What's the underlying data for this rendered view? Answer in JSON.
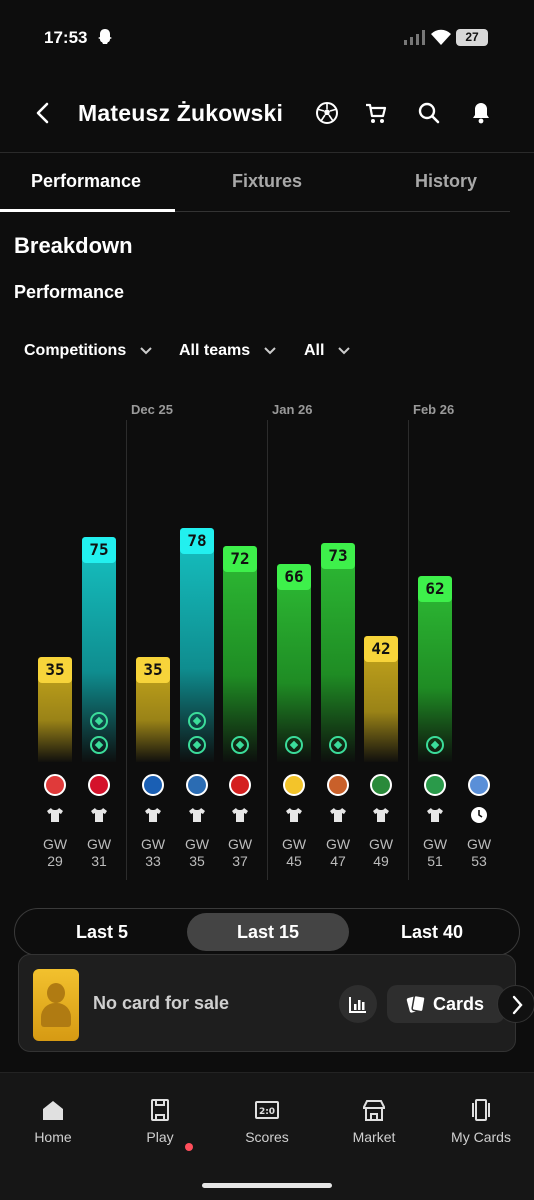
{
  "status": {
    "time": "17:53",
    "battery": "27"
  },
  "header": {
    "title": "Mateusz Żukowski"
  },
  "tabs": [
    {
      "label": "Performance",
      "active": true
    },
    {
      "label": "Fixtures",
      "active": false
    },
    {
      "label": "History",
      "active": false
    }
  ],
  "breakdown": {
    "heading": "Breakdown",
    "subheading": "Performance"
  },
  "filters": {
    "competitions": "Competitions",
    "teams": "All teams",
    "all": "All"
  },
  "chart_data": {
    "type": "bar",
    "months": [
      "Dec 25",
      "Jan 26",
      "Feb 26"
    ],
    "categories": [
      "GW 29",
      "GW 31",
      "GW 33",
      "GW 35",
      "GW 37",
      "GW 45",
      "GW 47",
      "GW 49",
      "GW 51",
      "GW 53"
    ],
    "values": [
      35,
      75,
      35,
      78,
      72,
      66,
      73,
      42,
      62,
      null
    ],
    "bar_colors": [
      "yellow",
      "cyan",
      "yellow",
      "cyan",
      "green",
      "green",
      "green",
      "yellow",
      "green",
      "none"
    ],
    "gw_prefix": "GW",
    "gw_numbers": [
      "29",
      "31",
      "33",
      "35",
      "37",
      "45",
      "47",
      "49",
      "51",
      "53"
    ]
  },
  "range": {
    "options": [
      "Last 5",
      "Last 15",
      "Last 40"
    ],
    "selected": "Last 15"
  },
  "sale": {
    "text": "No card for sale",
    "cards_label": "Cards"
  },
  "nav": {
    "items": [
      {
        "label": "Home",
        "icon": "home-icon"
      },
      {
        "label": "Play",
        "icon": "play-icon"
      },
      {
        "label": "Scores",
        "icon": "scores-icon"
      },
      {
        "label": "Market",
        "icon": "market-icon"
      },
      {
        "label": "My Cards",
        "icon": "my-cards-icon"
      }
    ]
  },
  "colors": {
    "yellow": "#f7d43a",
    "cyan": "#22f0ef",
    "green": "#3ef04b",
    "notification": "#ff4e5b"
  }
}
